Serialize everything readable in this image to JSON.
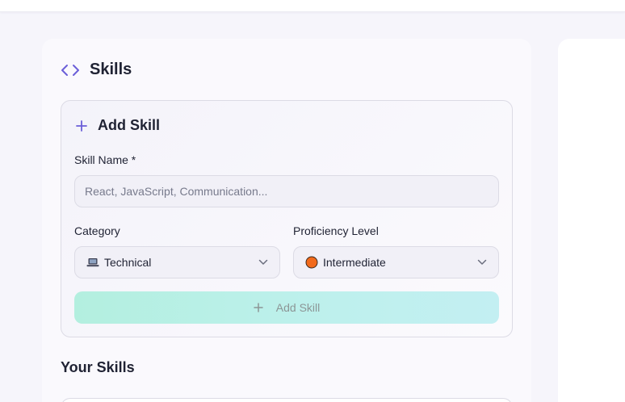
{
  "section": {
    "title": "Skills",
    "icon": "code-icon"
  },
  "add_form": {
    "title": "Add Skill",
    "skill_name_label": "Skill Name *",
    "skill_name_placeholder": "React, JavaScript, Communication...",
    "skill_name_value": "",
    "category_label": "Category",
    "category_value": "Technical",
    "category_icon": "laptop-icon",
    "proficiency_label": "Proficiency Level",
    "proficiency_value": "Intermediate",
    "proficiency_color": "#f26a1b",
    "submit_label": "Add Skill"
  },
  "list": {
    "title": "Your Skills"
  },
  "colors": {
    "accent": "#6b5fd8",
    "button_gradient_start": "#b3efdf",
    "button_gradient_end": "#c3eff2"
  }
}
